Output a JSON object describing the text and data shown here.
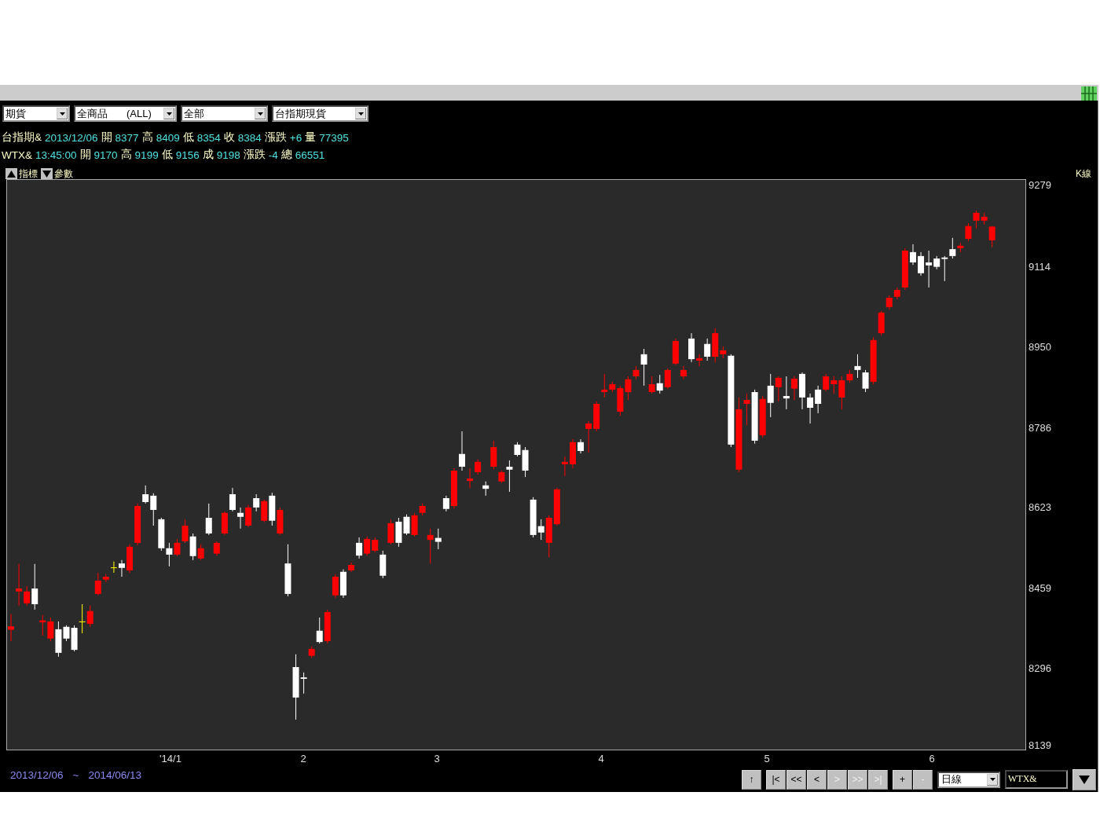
{
  "toolbar": {
    "dropdowns": [
      {
        "value": "期貨"
      },
      {
        "value": "全商品",
        "code": "(ALL)"
      },
      {
        "value": "全部"
      },
      {
        "value": "台指期現貨"
      }
    ]
  },
  "quote_lines": [
    [
      {
        "text": "台指期&",
        "kind": "label"
      },
      {
        "text": "2013/12/06",
        "kind": "value"
      },
      {
        "text": "開",
        "kind": "label"
      },
      {
        "text": "8377",
        "kind": "value"
      },
      {
        "text": "高",
        "kind": "label"
      },
      {
        "text": "8409",
        "kind": "value"
      },
      {
        "text": "低",
        "kind": "label"
      },
      {
        "text": "8354",
        "kind": "value"
      },
      {
        "text": "收",
        "kind": "label"
      },
      {
        "text": "8384",
        "kind": "value"
      },
      {
        "text": "漲跌",
        "kind": "label"
      },
      {
        "text": "+6",
        "kind": "value"
      },
      {
        "text": "量",
        "kind": "label"
      },
      {
        "text": "77395",
        "kind": "value"
      }
    ],
    [
      {
        "text": "WTX&",
        "kind": "label"
      },
      {
        "text": "13:45:00",
        "kind": "value"
      },
      {
        "text": "開",
        "kind": "label"
      },
      {
        "text": "9170",
        "kind": "value"
      },
      {
        "text": "高",
        "kind": "label"
      },
      {
        "text": "9199",
        "kind": "value"
      },
      {
        "text": "低",
        "kind": "label"
      },
      {
        "text": "9156",
        "kind": "value"
      },
      {
        "text": "成",
        "kind": "label"
      },
      {
        "text": "9198",
        "kind": "value"
      },
      {
        "text": "漲跌",
        "kind": "label"
      },
      {
        "text": "-4",
        "kind": "value"
      },
      {
        "text": "總",
        "kind": "label"
      },
      {
        "text": "66551",
        "kind": "value"
      }
    ]
  ],
  "chart": {
    "indicator_button": "指標",
    "params_button": "參數",
    "type_label": "K線",
    "month_labels": [
      "'14/1",
      "2",
      "3",
      "4",
      "5",
      "6"
    ],
    "chart_data": {
      "type": "candlestick",
      "ylim": [
        8133,
        9293
      ],
      "yticks": [
        9279,
        9114,
        8950,
        8786,
        8623,
        8459,
        8296,
        8139
      ],
      "ohlc": [
        [
          8377,
          8409,
          8354,
          8384
        ],
        [
          8455,
          8511,
          8426,
          8461
        ],
        [
          8431,
          8466,
          8426,
          8455
        ],
        [
          8461,
          8511,
          8418,
          8429
        ],
        [
          8392,
          8407,
          8365,
          8396
        ],
        [
          8359,
          8402,
          8354,
          8394
        ],
        [
          8378,
          8394,
          8322,
          8330
        ],
        [
          8383,
          8386,
          8354,
          8359
        ],
        [
          8381,
          8386,
          8333,
          8336
        ],
        [
          8394,
          8429,
          8370,
          8394
        ],
        [
          8389,
          8426,
          8383,
          8415
        ],
        [
          8450,
          8493,
          8447,
          8477
        ],
        [
          8479,
          8490,
          8474,
          8485
        ],
        [
          8504,
          8516,
          8493,
          8504
        ],
        [
          8512,
          8519,
          8485,
          8503
        ],
        [
          8498,
          8551,
          8493,
          8546
        ],
        [
          8554,
          8634,
          8549,
          8629
        ],
        [
          8653,
          8671,
          8634,
          8637
        ],
        [
          8650,
          8655,
          8589,
          8621
        ],
        [
          8602,
          8605,
          8538,
          8543
        ],
        [
          8543,
          8554,
          8506,
          8530
        ],
        [
          8530,
          8562,
          8527,
          8554
        ],
        [
          8557,
          8602,
          8554,
          8589
        ],
        [
          8567,
          8573,
          8519,
          8527
        ],
        [
          8522,
          8551,
          8519,
          8543
        ],
        [
          8605,
          8634,
          8570,
          8573
        ],
        [
          8532,
          8557,
          8528,
          8554
        ],
        [
          8573,
          8618,
          8570,
          8615
        ],
        [
          8653,
          8666,
          8618,
          8621
        ],
        [
          8615,
          8626,
          8583,
          8607
        ],
        [
          8589,
          8631,
          8586,
          8626
        ],
        [
          8645,
          8653,
          8618,
          8626
        ],
        [
          8599,
          8642,
          8596,
          8639
        ],
        [
          8650,
          8656,
          8589,
          8599
        ],
        [
          8573,
          8626,
          8570,
          8621
        ],
        [
          8512,
          8551,
          8445,
          8450
        ],
        [
          8301,
          8327,
          8194,
          8239
        ],
        [
          8280,
          8290,
          8247,
          8277
        ],
        [
          8324,
          8343,
          8320,
          8338
        ],
        [
          8375,
          8402,
          8349,
          8352
        ],
        [
          8354,
          8418,
          8349,
          8413
        ],
        [
          8447,
          8490,
          8442,
          8485
        ],
        [
          8495,
          8500,
          8442,
          8447
        ],
        [
          8498,
          8514,
          8495,
          8509
        ],
        [
          8554,
          8565,
          8522,
          8528
        ],
        [
          8532,
          8567,
          8528,
          8562
        ],
        [
          8538,
          8565,
          8535,
          8560
        ],
        [
          8530,
          8538,
          8482,
          8487
        ],
        [
          8554,
          8602,
          8551,
          8594
        ],
        [
          8597,
          8605,
          8546,
          8554
        ],
        [
          8607,
          8612,
          8570,
          8573
        ],
        [
          8570,
          8615,
          8567,
          8610
        ],
        [
          8615,
          8634,
          8610,
          8629
        ],
        [
          8560,
          8583,
          8512,
          8570
        ],
        [
          8564,
          8583,
          8541,
          8556
        ],
        [
          8645,
          8650,
          8618,
          8623
        ],
        [
          8629,
          8706,
          8624,
          8701
        ],
        [
          8735,
          8781,
          8701,
          8709
        ],
        [
          8680,
          8706,
          8666,
          8685
        ],
        [
          8698,
          8724,
          8693,
          8719
        ],
        [
          8671,
          8679,
          8650,
          8664
        ],
        [
          8709,
          8762,
          8704,
          8749
        ],
        [
          8679,
          8701,
          8676,
          8698
        ],
        [
          8709,
          8722,
          8658,
          8703
        ],
        [
          8754,
          8759,
          8730,
          8733
        ],
        [
          8743,
          8749,
          8688,
          8701
        ],
        [
          8642,
          8647,
          8565,
          8570
        ],
        [
          8588,
          8602,
          8560,
          8575
        ],
        [
          8554,
          8610,
          8525,
          8605
        ],
        [
          8592,
          8666,
          8589,
          8663
        ],
        [
          8714,
          8730,
          8690,
          8719
        ],
        [
          8714,
          8765,
          8706,
          8759
        ],
        [
          8759,
          8765,
          8736,
          8741
        ],
        [
          8786,
          8802,
          8738,
          8797
        ],
        [
          8786,
          8842,
          8781,
          8837
        ],
        [
          8861,
          8898,
          8850,
          8866
        ],
        [
          8866,
          8882,
          8861,
          8877
        ],
        [
          8821,
          8874,
          8813,
          8869
        ],
        [
          8861,
          8893,
          8845,
          8887
        ],
        [
          8893,
          8914,
          8887,
          8906
        ],
        [
          8938,
          8949,
          8874,
          8917
        ],
        [
          8861,
          8893,
          8858,
          8877
        ],
        [
          8879,
          8896,
          8858,
          8864
        ],
        [
          8871,
          8909,
          8868,
          8906
        ],
        [
          8919,
          8970,
          8916,
          8965
        ],
        [
          8893,
          8914,
          8887,
          8906
        ],
        [
          8970,
          8981,
          8922,
          8928
        ],
        [
          8925,
          8938,
          8914,
          8930
        ],
        [
          8959,
          8970,
          8925,
          8933
        ],
        [
          8933,
          8991,
          8922,
          8981
        ],
        [
          8938,
          8954,
          8930,
          8946
        ],
        [
          8935,
          8938,
          8749,
          8754
        ],
        [
          8703,
          8850,
          8698,
          8826
        ],
        [
          8837,
          8858,
          8794,
          8845
        ],
        [
          8861,
          8866,
          8756,
          8762
        ],
        [
          8773,
          8853,
          8768,
          8847
        ],
        [
          8874,
          8898,
          8810,
          8839
        ],
        [
          8871,
          8893,
          8842,
          8890
        ],
        [
          8853,
          8893,
          8826,
          8848
        ],
        [
          8868,
          8893,
          8845,
          8888
        ],
        [
          8898,
          8901,
          8826,
          8850
        ],
        [
          8850,
          8858,
          8797,
          8829
        ],
        [
          8866,
          8874,
          8818,
          8837
        ],
        [
          8866,
          8898,
          8863,
          8893
        ],
        [
          8877,
          8893,
          8858,
          8885
        ],
        [
          8850,
          8893,
          8826,
          8885
        ],
        [
          8885,
          8906,
          8880,
          8898
        ],
        [
          8914,
          8938,
          8890,
          8906
        ],
        [
          8901,
          8906,
          8861,
          8868
        ],
        [
          8882,
          8973,
          8877,
          8967
        ],
        [
          8981,
          9026,
          8976,
          9023
        ],
        [
          9034,
          9058,
          9029,
          9053
        ],
        [
          9055,
          9074,
          9050,
          9069
        ],
        [
          9074,
          9154,
          9069,
          9149
        ],
        [
          9146,
          9162,
          9120,
          9125
        ],
        [
          9138,
          9146,
          9098,
          9103
        ],
        [
          9125,
          9149,
          9074,
          9119
        ],
        [
          9133,
          9138,
          9111,
          9116
        ],
        [
          9135,
          9138,
          9087,
          9132
        ],
        [
          9152,
          9175,
          9133,
          9138
        ],
        [
          9154,
          9165,
          9146,
          9159
        ],
        [
          9173,
          9205,
          9168,
          9199
        ],
        [
          9210,
          9231,
          9194,
          9226
        ],
        [
          9210,
          9226,
          9202,
          9218
        ],
        [
          9170,
          9199,
          9156,
          9198
        ]
      ]
    }
  },
  "range": {
    "from": "2013/12/06",
    "separator": "~",
    "to": "2014/06/13"
  },
  "nav_groups": [
    [
      {
        "label": "↑",
        "disabled": false
      }
    ],
    [
      {
        "label": "|<",
        "disabled": false
      },
      {
        "label": "<<",
        "disabled": false
      },
      {
        "label": "<",
        "disabled": false
      },
      {
        "label": ">",
        "disabled": true
      },
      {
        "label": ">>",
        "disabled": true
      },
      {
        "label": ">|",
        "disabled": true
      }
    ],
    [
      {
        "label": "+",
        "disabled": false
      },
      {
        "label": "-",
        "disabled": true
      }
    ]
  ],
  "period": {
    "value": "日線"
  },
  "symbol": {
    "value": "WTX&"
  }
}
